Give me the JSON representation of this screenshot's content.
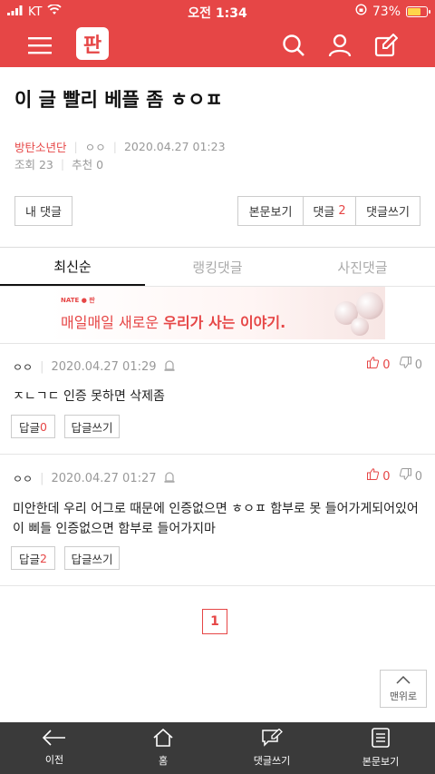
{
  "status": {
    "carrier": "KT",
    "time": "오전 1:34",
    "battery": "73%",
    "battery_fill": 0.73
  },
  "header": {
    "logo_text": "판",
    "icons": [
      "menu-icon",
      "search-icon",
      "user-icon",
      "edit-icon"
    ]
  },
  "post": {
    "title": "이 글 빨리 베플 좀 ㅎㅇㅍ",
    "author": "방탄소년단",
    "nickname": "ㅇㅇ",
    "datetime": "2020.04.27 01:23",
    "views": "조회 23",
    "recommends": "추천 0"
  },
  "actions": {
    "my_comments": "내 댓글",
    "view_post": "본문보기",
    "comments_label": "댓글",
    "comments_count": "2",
    "write_comment": "댓글쓰기"
  },
  "tabs": [
    "최신순",
    "랭킹댓글",
    "사진댓글"
  ],
  "banner": {
    "brand": "NATE ● 판",
    "text_prefix": "매일매일 새로운 ",
    "text_bold": "우리가 사는 이야기."
  },
  "comments": [
    {
      "nick": "ㅇㅇ",
      "datetime": "2020.04.27 01:29",
      "up": "0",
      "down": "0",
      "body": "ㅈㄴㄱㄷ 인증 못하면 삭제좀",
      "reply_label": "답글",
      "reply_count": "0",
      "write_reply": "답글쓰기"
    },
    {
      "nick": "ㅇㅇ",
      "datetime": "2020.04.27 01:27",
      "up": "0",
      "down": "0",
      "body": "미안한데 우리 어그로 때문에 인증없으면 ㅎㅇㅍ 함부로 못 들어가게되어있어 이 삐들 인증없으면 함부로 들어가지마",
      "reply_label": "답글",
      "reply_count": "2",
      "write_reply": "답글쓰기"
    }
  ],
  "pagination": {
    "current": "1"
  },
  "to_top": "맨위로",
  "bottom_nav": [
    {
      "label": "이전",
      "icon": "back-arrow-icon"
    },
    {
      "label": "홈",
      "icon": "home-icon"
    },
    {
      "label": "댓글쓰기",
      "icon": "comment-write-icon"
    },
    {
      "label": "본문보기",
      "icon": "document-icon"
    }
  ],
  "colors": {
    "brand": "#e64646",
    "bottom_bar": "#3a3a3a"
  }
}
